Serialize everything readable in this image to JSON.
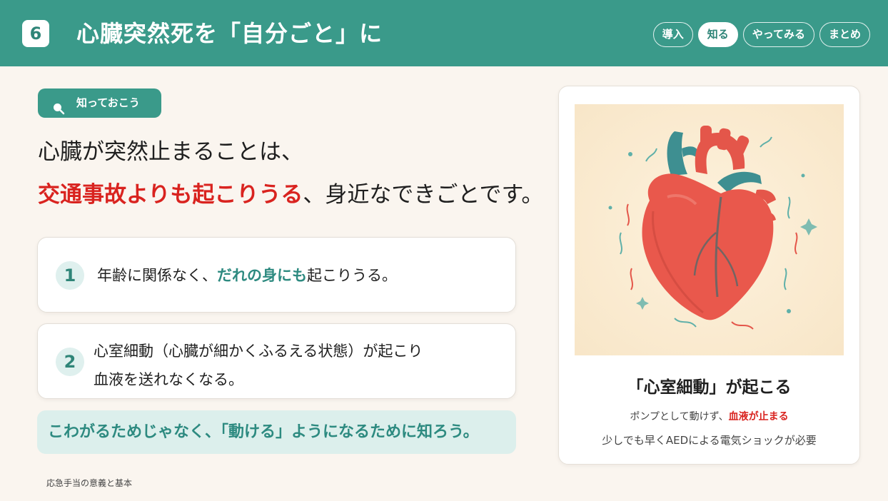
{
  "header": {
    "slide_number": "6",
    "title": "心臓突然死を「自分ごと」に",
    "nav": [
      {
        "label": "導入",
        "active": false
      },
      {
        "label": "知る",
        "active": true
      },
      {
        "label": "やってみる",
        "active": false
      },
      {
        "label": "まとめ",
        "active": false
      }
    ]
  },
  "tag": {
    "icon": "search-icon",
    "label": "知っておこう"
  },
  "lead": {
    "line1": "心臓が突然止まることは、",
    "line2_highlight": "交通事故よりも起こりうる",
    "line2_rest": "、身近なできごとです。"
  },
  "points": [
    {
      "number": "1",
      "text_before": "年齢に関係なく、",
      "text_highlight": "だれの身にも",
      "text_after": "起こりうる。"
    },
    {
      "number": "2",
      "line1": "心室細動（心臓が細かくふるえる状態）が起こり",
      "line2": "血液を送れなくなる。"
    }
  ],
  "note": "こわがるためじゃなく、「動ける」ようになるために知ろう。",
  "footer": "応急手当の意義と基本",
  "panel": {
    "image": "heart-illustration",
    "title": "「心室細動」が起こる",
    "line1_before": "ポンプとして動けず、",
    "line1_highlight": "血液が止まる",
    "line2": "少しでも早くAEDによる電気ショックが必要"
  },
  "colors": {
    "teal": "#3a9a8a",
    "accent_red": "#d9231f",
    "background": "#faf5ef"
  }
}
